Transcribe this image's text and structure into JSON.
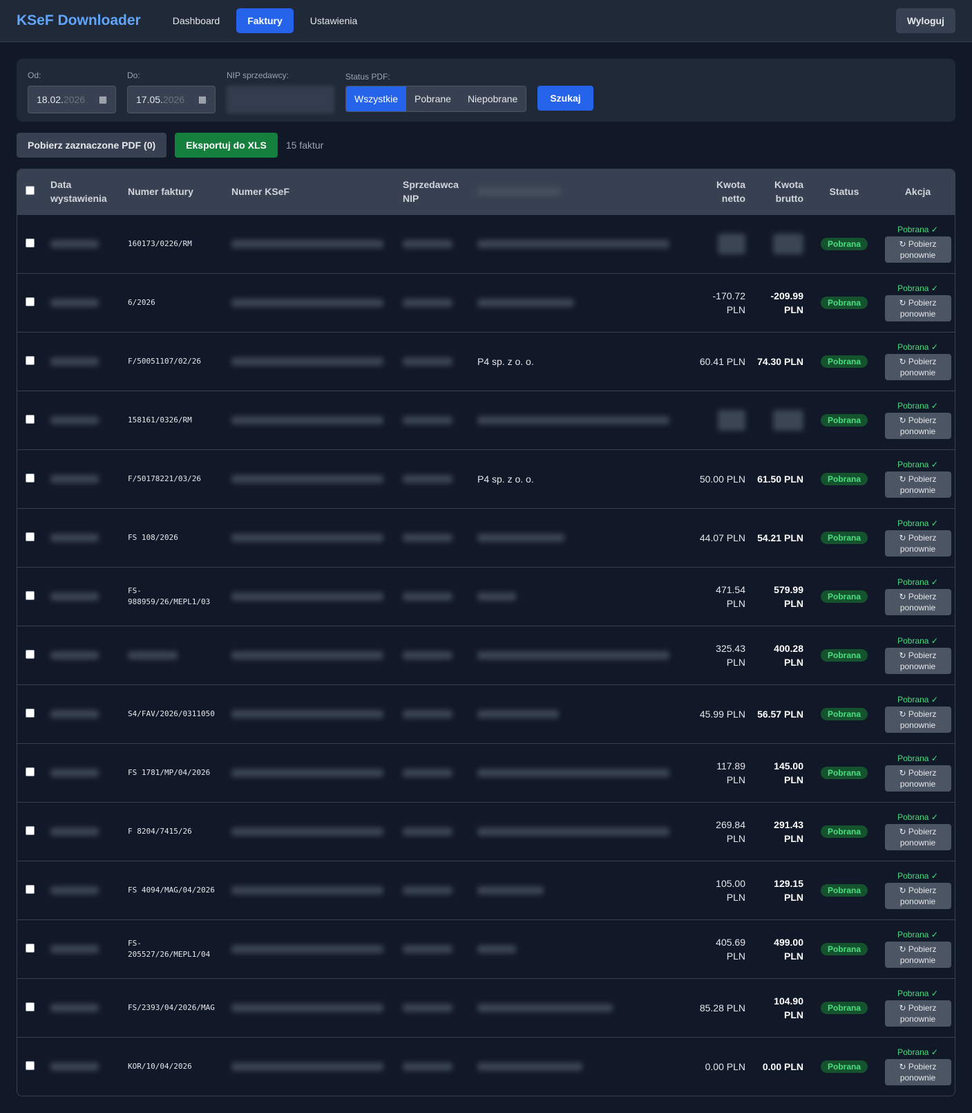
{
  "nav": {
    "brand": "KSeF Downloader",
    "links": [
      "Dashboard",
      "Faktury",
      "Ustawienia"
    ],
    "logout": "Wyloguj"
  },
  "filters": {
    "from_label": "Od:",
    "from_value": "18.02.",
    "from_year": "2026",
    "to_label": "Do:",
    "to_value": "17.05.",
    "to_year": "2026",
    "nip_label": "NIP sprzedawcy:",
    "status_label": "Status PDF:",
    "status_options": [
      "Wszystkie",
      "Pobrane",
      "Niepobrane"
    ],
    "search": "Szukaj"
  },
  "actions": {
    "download_selected": "Pobierz zaznaczone PDF (0)",
    "export_xls": "Eksportuj do XLS",
    "count": "15 faktur"
  },
  "table": {
    "headers": {
      "date": "Data wystawienia",
      "number": "Numer faktury",
      "ksef": "Numer KSeF",
      "nip": "Sprzedawca NIP",
      "netto": "Kwota netto",
      "brutto": "Kwota brutto",
      "status": "Status",
      "action": "Akcja"
    },
    "status_badge": "Pobrana",
    "downloaded_label": "Pobrana ✓",
    "redownload_label": "↻ Pobierz ponownie",
    "rows": [
      {
        "number": "160173/0226/RM",
        "seller": "",
        "netto": "",
        "brutto": ""
      },
      {
        "number": "6/2026",
        "seller": "",
        "netto": "-170.72 PLN",
        "brutto": "-209.99 PLN"
      },
      {
        "number": "F/50051107/02/26",
        "seller": "P4 sp. z o. o.",
        "netto": "60.41 PLN",
        "brutto": "74.30 PLN"
      },
      {
        "number": "158161/0326/RM",
        "seller": "",
        "netto": "",
        "brutto": ""
      },
      {
        "number": "F/50178221/03/26",
        "seller": "P4 sp. z o. o.",
        "netto": "50.00 PLN",
        "brutto": "61.50 PLN"
      },
      {
        "number": "FS 108/2026",
        "seller": "",
        "netto": "44.07 PLN",
        "brutto": "54.21 PLN"
      },
      {
        "number": "FS-988959/26/MEPL1/03",
        "seller": "",
        "netto": "471.54 PLN",
        "brutto": "579.99 PLN"
      },
      {
        "number": "",
        "seller": "",
        "netto": "325.43 PLN",
        "brutto": "400.28 PLN"
      },
      {
        "number": "S4/FAV/2026/0311050",
        "seller": "",
        "netto": "45.99 PLN",
        "brutto": "56.57 PLN"
      },
      {
        "number": "FS 1781/MP/04/2026",
        "seller": "",
        "netto": "117.89 PLN",
        "brutto": "145.00 PLN"
      },
      {
        "number": "F 8204/7415/26",
        "seller": "",
        "netto": "269.84 PLN",
        "brutto": "291.43 PLN"
      },
      {
        "number": "FS 4094/MAG/04/2026",
        "seller": "",
        "netto": "105.00 PLN",
        "brutto": "129.15 PLN"
      },
      {
        "number": "FS-205527/26/MEPL1/04",
        "seller": "",
        "netto": "405.69 PLN",
        "brutto": "499.00 PLN"
      },
      {
        "number": "FS/2393/04/2026/MAG",
        "seller": "",
        "netto": "85.28 PLN",
        "brutto": "104.90 PLN"
      },
      {
        "number": "KOR/10/04/2026",
        "seller": "",
        "netto": "0.00 PLN",
        "brutto": "0.00 PLN"
      }
    ]
  }
}
